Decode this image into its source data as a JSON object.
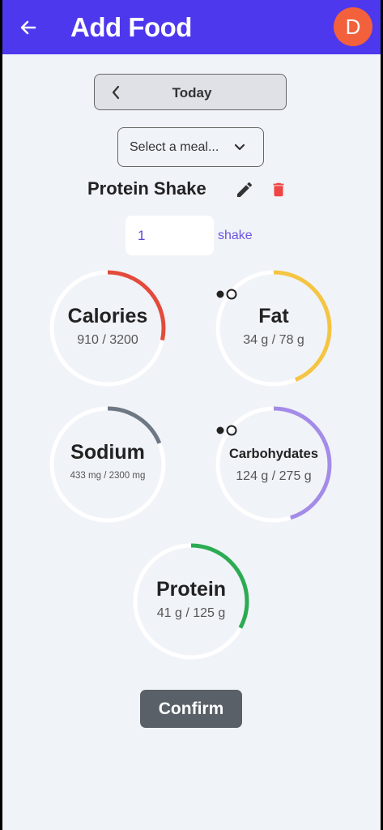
{
  "header": {
    "title": "Add Food",
    "avatar_initial": "D",
    "bar_color": "#4e38ee",
    "avatar_color": "#f2603c",
    "back_icon": "arrow-left-icon"
  },
  "date_selector": {
    "label": "Today",
    "icon": "chevron-left-icon"
  },
  "meal_select": {
    "placeholder": "Select a meal...",
    "icon": "chevron-down-icon"
  },
  "food": {
    "name": "Protein Shake",
    "edit_icon": "pencil-icon",
    "delete_icon": "trash-icon",
    "delete_color": "#ef4444"
  },
  "quantity": {
    "value": "1",
    "unit": "shake"
  },
  "nutrients": {
    "calories": {
      "label": "Calories",
      "value": "910 / 3200",
      "progress": 0.284,
      "color": "#e34b3b"
    },
    "fat": {
      "label": "Fat",
      "value": "34 g / 78 g",
      "progress": 0.436,
      "color": "#f4c542"
    },
    "sodium": {
      "label": "Sodium",
      "value": "433 mg / 2300 mg",
      "progress": 0.188,
      "color": "#6e7784"
    },
    "carbohydrates": {
      "label": "Carbohydates",
      "value": "124 g / 275 g",
      "progress": 0.451,
      "color": "#a48be8"
    },
    "protein": {
      "label": "Protein",
      "value": "41 g / 125 g",
      "progress": 0.328,
      "color": "#2cab52"
    }
  },
  "actions": {
    "confirm_label": "Confirm"
  }
}
